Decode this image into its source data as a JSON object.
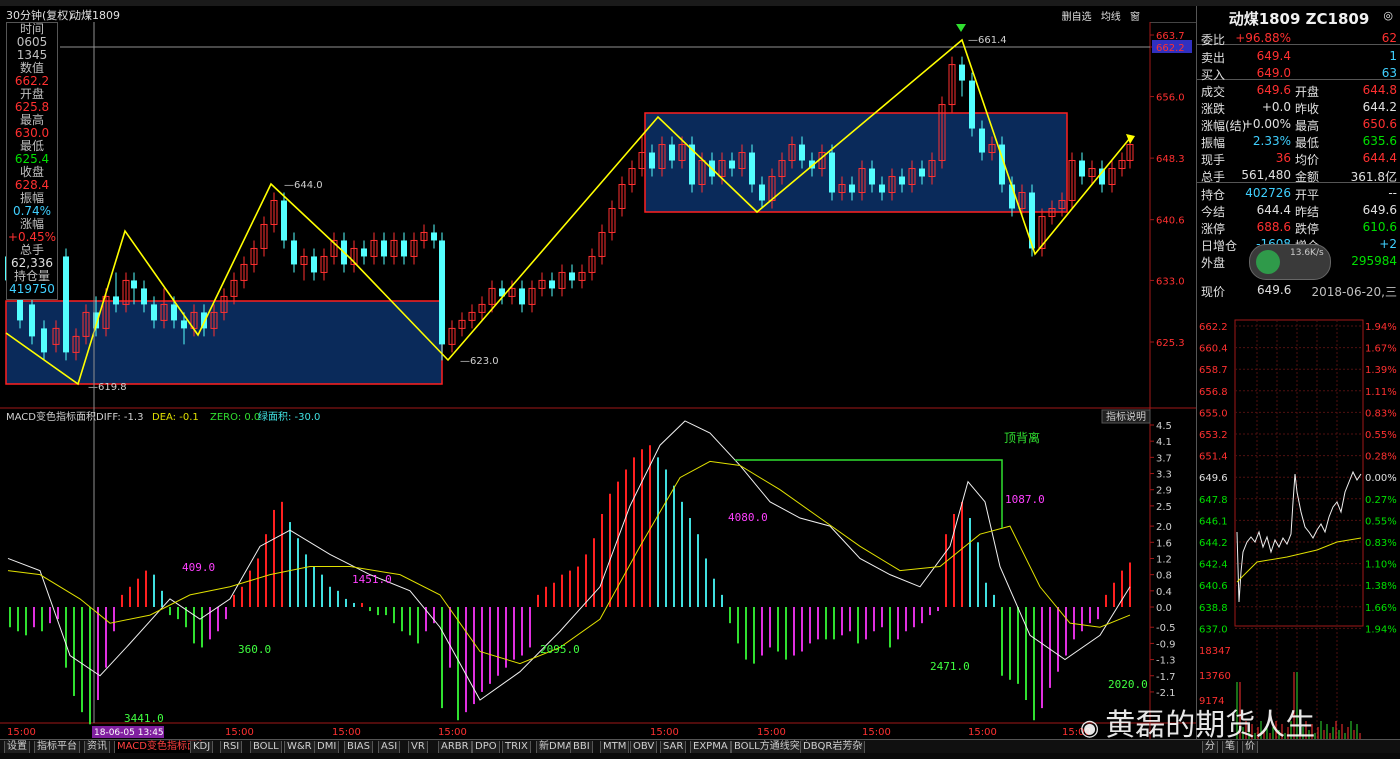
{
  "titlebar": {
    "period": "30分钟(复权)",
    "symbol": "动煤1809",
    "buttons": [
      "删自选",
      "均线",
      "窗"
    ]
  },
  "infobox": [
    {
      "t": "时间",
      "c": "#c0c0c0"
    },
    {
      "t": "0605",
      "c": "#c0c0c0"
    },
    {
      "t": "1345",
      "c": "#c0c0c0"
    },
    {
      "t": "数值",
      "c": "#c0c0c0"
    },
    {
      "t": "662.2",
      "c": "#ff3030"
    },
    {
      "t": "开盘",
      "c": "#c0c0c0"
    },
    {
      "t": "625.8",
      "c": "#ff3030"
    },
    {
      "t": "最高",
      "c": "#c0c0c0"
    },
    {
      "t": "630.0",
      "c": "#ff3030"
    },
    {
      "t": "最低",
      "c": "#c0c0c0"
    },
    {
      "t": "625.4",
      "c": "#00e000"
    },
    {
      "t": "收盘",
      "c": "#c0c0c0"
    },
    {
      "t": "628.4",
      "c": "#ff3030"
    },
    {
      "t": "振幅",
      "c": "#c0c0c0"
    },
    {
      "t": "0.74%",
      "c": "#40d0ff"
    },
    {
      "t": "涨幅",
      "c": "#c0c0c0"
    },
    {
      "t": "+0.45%",
      "c": "#ff3030"
    },
    {
      "t": "总手",
      "c": "#c0c0c0"
    },
    {
      "t": "62,336",
      "c": "#e0e0e0"
    },
    {
      "t": "持仓量",
      "c": "#c0c0c0"
    },
    {
      "t": "419750",
      "c": "#40d0ff"
    }
  ],
  "price_axis": {
    "labels": [
      "663.7",
      "662.2",
      "656.0",
      "648.3",
      "640.6",
      "633.0",
      "625.3"
    ],
    "highlight": "662.2"
  },
  "price_annotations": [
    "661.4",
    "644.0",
    "623.0",
    "619.8"
  ],
  "macd": {
    "header": {
      "name": "MACD变色指标面积",
      "diff": "DIFF: -1.3",
      "dea": "DEA: -0.1",
      "zero": "ZERO: 0.0",
      "area": "绿面积: -30.0"
    },
    "help_button": "指标说明",
    "axis": [
      "4.5",
      "4.1",
      "3.7",
      "3.3",
      "2.9",
      "2.5",
      "2.0",
      "1.6",
      "1.2",
      "0.8",
      "0.4",
      "0.0",
      "-0.5",
      "-0.9",
      "-1.3",
      "-1.7",
      "-2.1"
    ],
    "area_labels": [
      {
        "t": "409.0",
        "c": "#ff40ff"
      },
      {
        "t": "360.0",
        "c": "#40ff40"
      },
      {
        "t": "1451.0",
        "c": "#ff40ff"
      },
      {
        "t": "3441.0",
        "c": "#40ff40"
      },
      {
        "t": "2095.0",
        "c": "#40ff40"
      },
      {
        "t": "4080.0",
        "c": "#ff40ff"
      },
      {
        "t": "1087.0",
        "c": "#ff40ff"
      },
      {
        "t": "2471.0",
        "c": "#40ff40"
      },
      {
        "t": "2020.0",
        "c": "#40ff40"
      }
    ],
    "divergence_label": "顶背离"
  },
  "time_axis": {
    "labels": [
      "15:00",
      "15:00",
      "15:00",
      "15:00",
      "15:00",
      "15:00",
      "15:00",
      "15:00",
      "15:00"
    ],
    "cursor_label": "18-06-05 13:45"
  },
  "rightpanel": {
    "title": "动煤1809 ZC1809",
    "num": "◎",
    "rows": [
      {
        "l": "委比",
        "v": "+96.88%",
        "vc": "#ff3030",
        "r": "",
        "rv": "62",
        "rvc": "#ff3030"
      },
      {
        "l": "卖出",
        "v": "649.4",
        "vc": "#ff3030",
        "r": "",
        "rv": "1",
        "rvc": "#40d0ff"
      },
      {
        "l": "买入",
        "v": "649.0",
        "vc": "#ff3030",
        "r": "",
        "rv": "63",
        "rvc": "#40d0ff"
      },
      {
        "l": "成交",
        "v": "649.6",
        "vc": "#ff3030",
        "r": "开盘",
        "rv": "644.8",
        "rvc": "#ff3030"
      },
      {
        "l": "涨跌",
        "v": "+0.0",
        "vc": "#e0e0e0",
        "r": "昨收",
        "rv": "644.2",
        "rvc": "#e0e0e0"
      },
      {
        "l": "涨幅(结)",
        "v": "+0.00%",
        "vc": "#e0e0e0",
        "r": "最高",
        "rv": "650.6",
        "rvc": "#ff3030"
      },
      {
        "l": "振幅",
        "v": "2.33%",
        "vc": "#40d0ff",
        "r": "最低",
        "rv": "635.6",
        "rvc": "#00e000"
      },
      {
        "l": "现手",
        "v": "36",
        "vc": "#ff3030",
        "r": "均价",
        "rv": "644.4",
        "rvc": "#ff3030"
      },
      {
        "l": "总手",
        "v": "561,480",
        "vc": "#e0e0e0",
        "r": "金额",
        "rv": "361.8亿",
        "rvc": "#e0e0e0"
      },
      {
        "l": "持仓",
        "v": "402726",
        "vc": "#40d0ff",
        "r": "开平",
        "rv": "--",
        "rvc": "#e0e0e0"
      },
      {
        "l": "今结",
        "v": "644.4",
        "vc": "#e0e0e0",
        "r": "昨结",
        "rv": "649.6",
        "rvc": "#e0e0e0"
      },
      {
        "l": "涨停",
        "v": "688.6",
        "vc": "#ff3030",
        "r": "跌停",
        "rv": "610.6",
        "rvc": "#00e000"
      },
      {
        "l": "日增仓",
        "v": "-1608",
        "vc": "#40d0ff",
        "r": "增仓",
        "rv": "+2",
        "rvc": "#40d0ff"
      },
      {
        "l": "外盘",
        "v": "",
        "vc": "#e0e0e0",
        "r": "内盘",
        "rv": "295984",
        "rvc": "#00e000"
      }
    ],
    "fund_speed": "13.6K/s",
    "current_price_label": "现价",
    "current_price": "649.6",
    "date": "2018-06-20,三",
    "intraday_axis_left": [
      "662.2",
      "660.4",
      "658.7",
      "656.8",
      "655.0",
      "653.2",
      "651.4",
      "649.6",
      "647.8",
      "646.1",
      "644.2",
      "642.4",
      "640.6",
      "638.8",
      "637.0"
    ],
    "intraday_axis_right": [
      "1.94%",
      "1.67%",
      "1.39%",
      "1.11%",
      "0.83%",
      "0.55%",
      "0.28%",
      "0.00%",
      "0.27%",
      "0.55%",
      "0.83%",
      "1.10%",
      "1.38%",
      "1.66%",
      "1.94%"
    ],
    "volume_axis": [
      "18347",
      "13760",
      "9174"
    ],
    "bottom_tabs": [
      "分",
      "笔",
      "价"
    ]
  },
  "bottom_tabs": [
    "设置",
    "指标平台",
    "资讯",
    "MACD变色指标面积",
    "KDJ",
    "RSI",
    "BOLL",
    "W&R",
    "DMI",
    "BIAS",
    "ASI",
    "VR",
    "ARBR",
    "DPO",
    "TRIX",
    "新DMA",
    "BBI",
    "MTM",
    "OBV",
    "SAR",
    "EXPMA",
    "BOLL方通线突破",
    "DBQR岩芳杂"
  ],
  "watermark": "黄磊的期货人生",
  "colors": {
    "up": "#ff3030",
    "down": "#54ffff",
    "box": "#0a2a5a",
    "zigzag": "#ffff00",
    "macd_red": "#ff2020",
    "macd_cyan": "#40e0e0",
    "macd_green": "#30e030",
    "macd_magenta": "#e030e0"
  }
}
